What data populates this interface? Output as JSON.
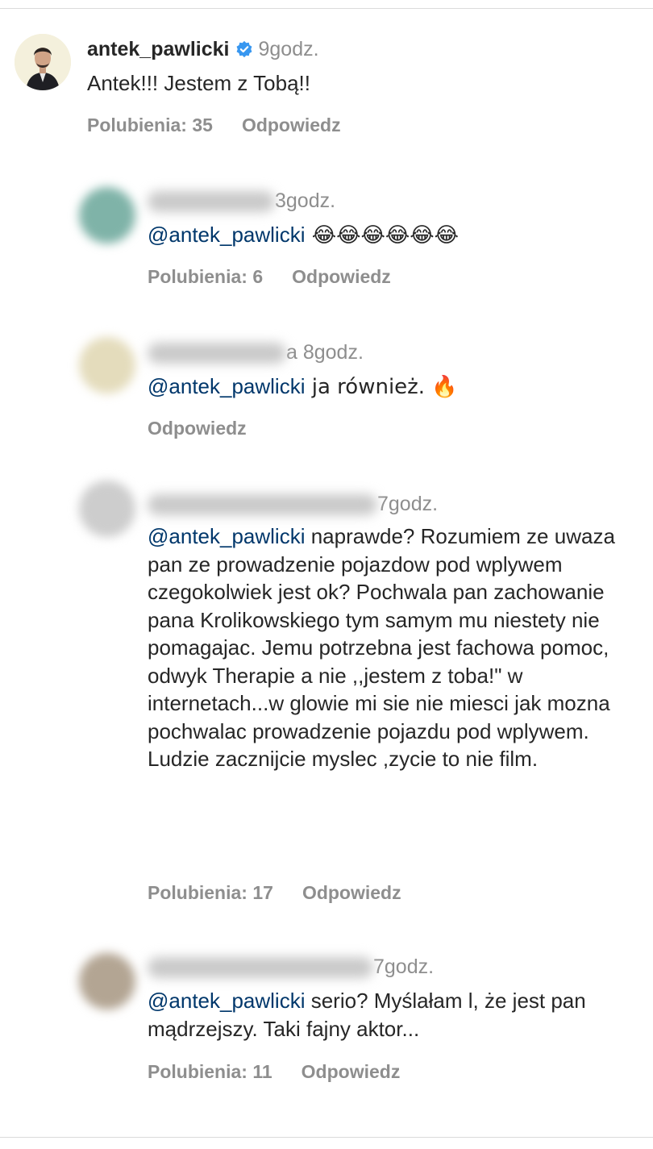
{
  "main_comment": {
    "username": "antek_pawlicki",
    "time": "9godz.",
    "text": "Antek!!! Jestem z Tobą!!",
    "likes": "Polubienia: 35",
    "reply": "Odpowiedz"
  },
  "replies": [
    {
      "time": "3godz.",
      "mention": "@antek_pawlicki",
      "text": " 😂😂😂😂😂😂",
      "likes": "Polubienia: 6",
      "reply": "Odpowiedz"
    },
    {
      "time": "a 8godz.",
      "mention": "@antek_pawlicki",
      "text": " ja również. 🔥",
      "likes": "",
      "reply": "Odpowiedz"
    },
    {
      "time": "7godz.",
      "mention": "@antek_pawlicki",
      "text": " naprawde? Rozumiem ze uwaza pan ze prowadzenie pojazdow pod wplywem czegokolwiek jest ok? Pochwala pan zachowanie pana Krolikowskiego tym samym mu niestety nie pomagajac. Jemu potrzebna jest fachowa pomoc, odwyk Therapie a nie ,,jestem z toba!\" w internetach...w glowie mi sie nie miesci jak mozna pochwalac prowadzenie pojazdu pod wplywem. Ludzie zacznijcie myslec ,zycie to nie film.",
      "likes": "Polubienia: 17",
      "reply": "Odpowiedz"
    },
    {
      "time": "7godz.",
      "mention": "@antek_pawlicki",
      "text": " serio? Myślałam l, że jest pan mądrzejszy. Taki fajny aktor...",
      "likes": "Polubienia: 11",
      "reply": "Odpowiedz"
    }
  ],
  "colors": {
    "mention": "#00376b",
    "muted": "#8e8e8e",
    "verified": "#3897f0"
  }
}
